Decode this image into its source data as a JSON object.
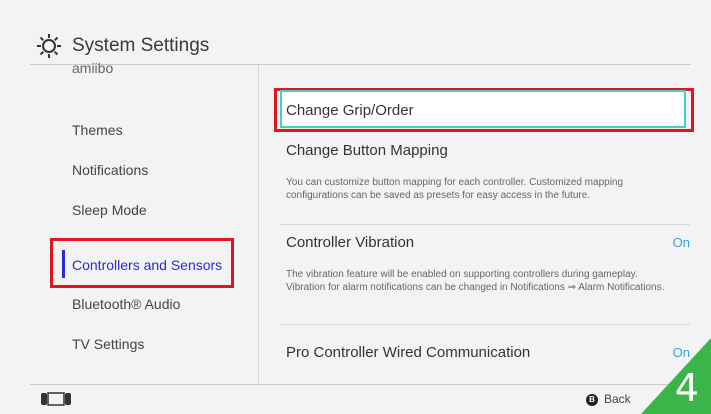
{
  "header": {
    "title": "System Settings",
    "icon": "gear-icon"
  },
  "sidebar": {
    "items": [
      {
        "label": "amiibo"
      },
      {
        "label": "Themes"
      },
      {
        "label": "Notifications"
      },
      {
        "label": "Sleep Mode"
      },
      {
        "label": "Controllers and Sensors",
        "active": true
      },
      {
        "label": "Bluetooth® Audio"
      },
      {
        "label": "TV Settings"
      }
    ]
  },
  "content": {
    "rows": [
      {
        "label": "Change Grip/Order",
        "selected": true
      },
      {
        "label": "Change Button Mapping",
        "description": "You can customize button mapping for each controller. Customized mapping configurations can be saved as presets for easy access in the future."
      },
      {
        "label": "Controller Vibration",
        "value": "On",
        "description": "The vibration feature will be enabled on supporting controllers during gameplay. Vibration for alarm notifications can be changed in Notifications ⇒ Alarm Notifications."
      },
      {
        "label": "Pro Controller Wired Communication",
        "value": "On"
      }
    ]
  },
  "footer": {
    "back_button_glyph": "B",
    "back_label": "Back",
    "corner_badge": "4"
  },
  "colors": {
    "selection_border": "#e0161e",
    "active_accent": "#2a2bd6",
    "value_text": "#3aa0d8",
    "badge": "#3bb54a"
  }
}
